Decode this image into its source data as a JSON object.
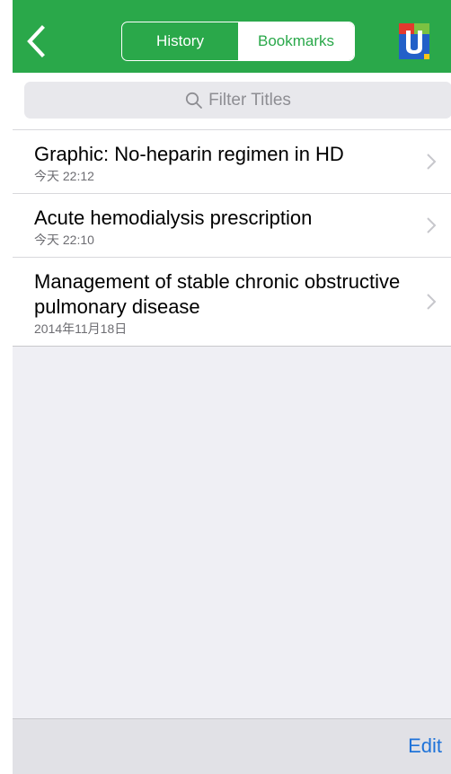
{
  "nav": {
    "back_icon": "chevron-left-icon",
    "segments": [
      {
        "label": "History",
        "selected": false
      },
      {
        "label": "Bookmarks",
        "selected": true
      }
    ],
    "logo_letter": "U",
    "logo_icon": "uptodate-logo-icon",
    "colors": {
      "nav_bg": "#2aa84a",
      "logo_blue": "#2360c8",
      "logo_red": "#e23a2e",
      "logo_green": "#7cc242",
      "logo_yellow": "#f5c518"
    }
  },
  "search": {
    "placeholder": "Filter Titles",
    "icon": "search-icon"
  },
  "bookmarks": [
    {
      "title": "Graphic: No-heparin regimen in HD",
      "timestamp": "今天 22:12"
    },
    {
      "title": "Acute hemodialysis prescription",
      "timestamp": "今天 22:10"
    },
    {
      "title": "Management of stable chronic obstructive pulmonary disease",
      "timestamp": "2014年11月18日"
    }
  ],
  "toolbar": {
    "edit_label": "Edit",
    "edit_color": "#1f73d9"
  }
}
